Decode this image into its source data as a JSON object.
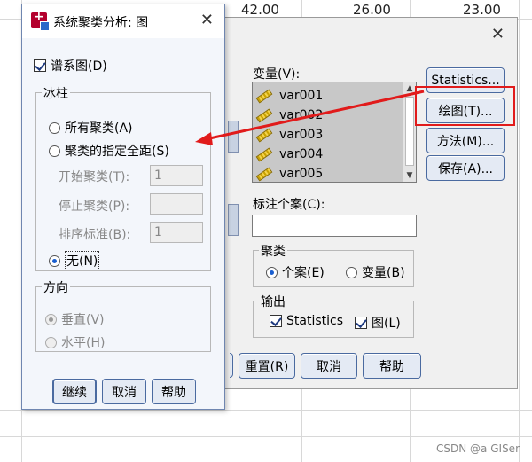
{
  "background": {
    "cells": [
      "42.00",
      "26.00",
      "23.00"
    ],
    "watermark": "CSDN @a  GISer"
  },
  "main_dialog": {
    "variables_label": "变量(V):",
    "variables": [
      "var001",
      "var002",
      "var003",
      "var004",
      "var005"
    ],
    "label_cases_label": "标注个案(C):",
    "label_cases_value": "",
    "buttons": {
      "statistics": "Statistics...",
      "plots": "绘图(T)...",
      "method": "方法(M)...",
      "save": "保存(A)..."
    },
    "cluster_group": {
      "title": "聚类",
      "cases": "个案(E)",
      "variables": "变量(B)",
      "selected": "cases"
    },
    "display_group": {
      "title": "输出",
      "statistics": "Statistics",
      "plots": "图(L)",
      "statistics_checked": true,
      "plots_checked": true
    },
    "bottom_buttons": {
      "reset": "重置(R)",
      "cancel": "取消",
      "help": "帮助"
    }
  },
  "plots_dialog": {
    "title": "系统聚类分析: 图",
    "dendrogram_label": "谱系图(D)",
    "dendrogram_checked": true,
    "icicle_group": {
      "title": "冰柱",
      "all_clusters": "所有聚类(A)",
      "specified_range": "聚类的指定全距(S)",
      "start_label": "开始聚类(T):",
      "start_value": "1",
      "stop_label": "停止聚类(P):",
      "stop_value": "",
      "by_label": "排序标准(B):",
      "by_value": "1",
      "none": "无(N)",
      "selected": "none"
    },
    "orientation_group": {
      "title": "方向",
      "vertical": "垂直(V)",
      "horizontal": "水平(H)",
      "selected": "vertical"
    },
    "buttons": {
      "continue": "继续",
      "cancel": "取消",
      "help": "帮助"
    }
  },
  "colors": {
    "annotation_red": "#e11b1b",
    "button_border": "#4a6aa0",
    "radio_selected": "#1a5fd0"
  }
}
